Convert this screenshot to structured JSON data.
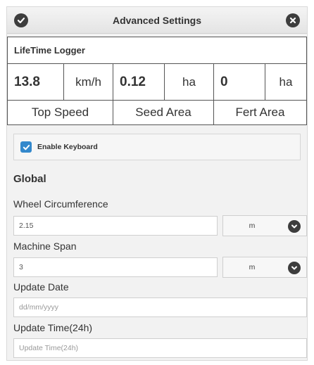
{
  "header": {
    "title": "Advanced Settings",
    "left_icon": "check-circle-icon",
    "right_icon": "close-circle-icon"
  },
  "logger": {
    "title": "LifeTime Logger",
    "metrics": [
      {
        "value": "13.8",
        "unit": "km/h",
        "label": "Top Speed"
      },
      {
        "value": "0.12",
        "unit": "ha",
        "label": "Seed Area"
      },
      {
        "value": "0",
        "unit": "ha",
        "label": "Fert Area"
      }
    ]
  },
  "keyboard": {
    "label": "Enable Keyboard",
    "checked": true
  },
  "global": {
    "heading": "Global",
    "wheel": {
      "label": "Wheel Circumference",
      "value": "2.15",
      "unit": "m"
    },
    "span": {
      "label": "Machine Span",
      "value": "3",
      "unit": "m"
    },
    "update_date": {
      "label": "Update Date",
      "placeholder": "dd/mm/yyyy"
    },
    "update_time": {
      "label": "Update Time(24h)",
      "placeholder": "Update Time(24h)"
    }
  },
  "colors": {
    "accent": "#3388cc",
    "icon_dark": "#3d3d3d"
  }
}
